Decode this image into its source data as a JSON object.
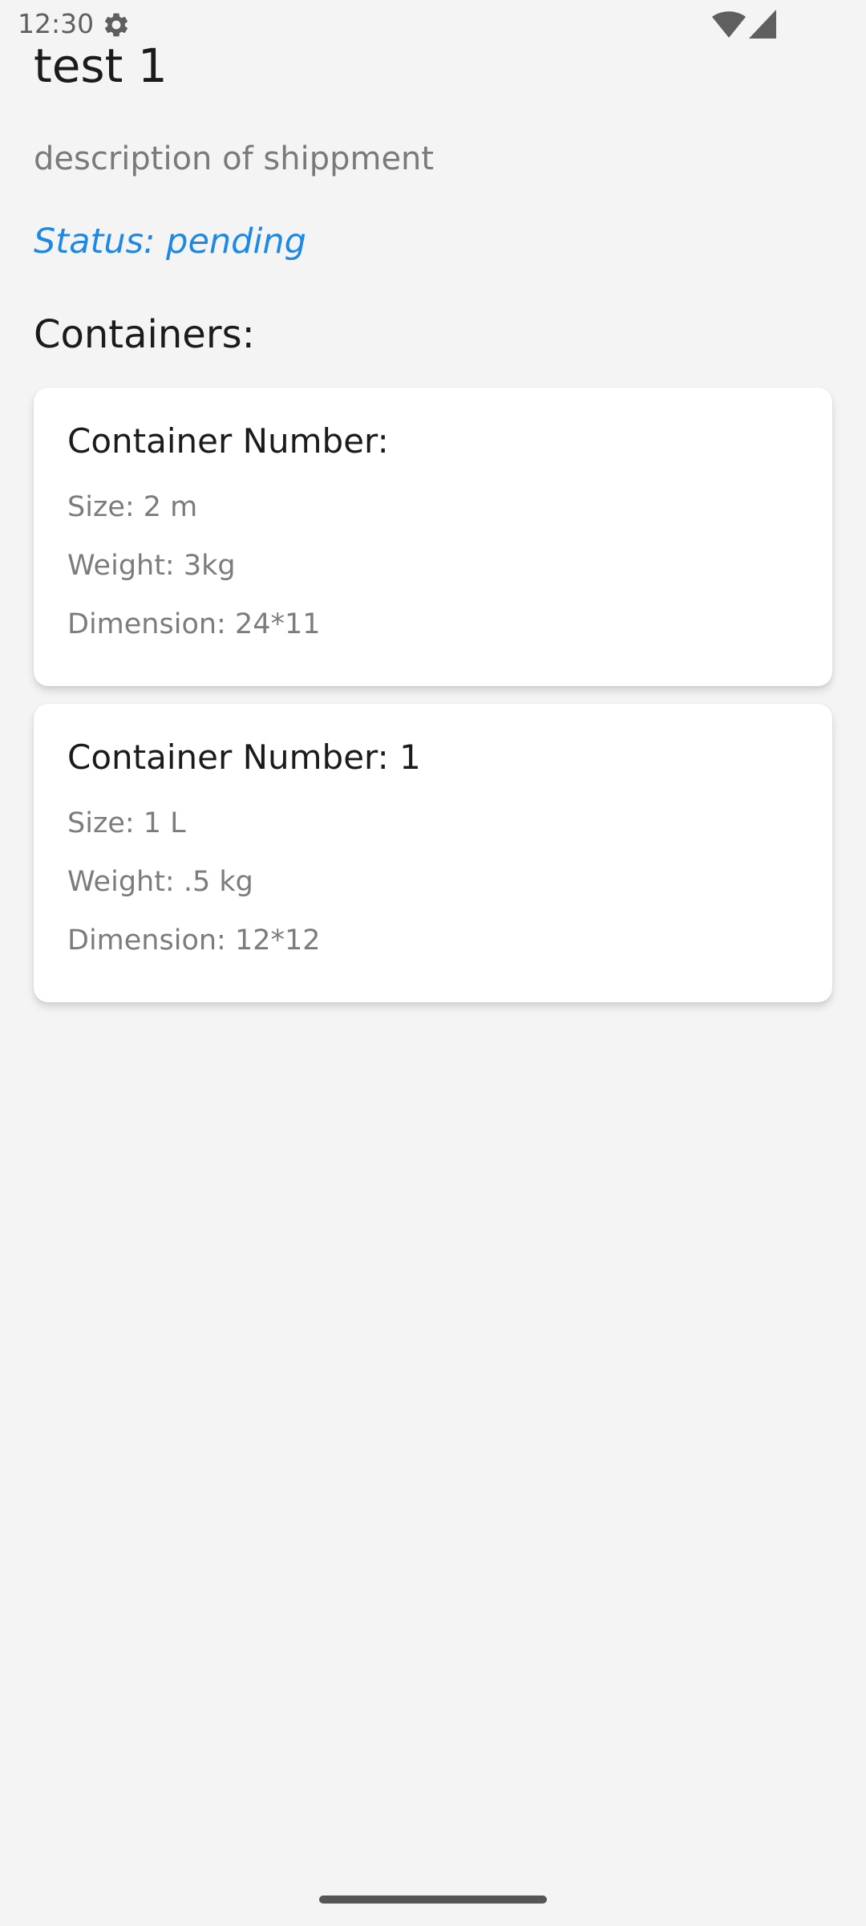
{
  "status_bar": {
    "time": "12:30",
    "icons": [
      "gear-icon",
      "wifi-icon",
      "signal-icon"
    ]
  },
  "shipment": {
    "title": "test 1",
    "description": "description of shippment",
    "status": "Status: pending"
  },
  "containers_heading": "Containers:",
  "containers": [
    {
      "number": "Container Number:",
      "size": "Size: 2 m",
      "weight": "Weight: 3kg",
      "dimension": "Dimension: 24*11"
    },
    {
      "number": "Container Number: 1",
      "size": "Size: 1 L",
      "weight": "Weight: .5 kg",
      "dimension": "Dimension: 12*12"
    }
  ],
  "colors": {
    "background": "#f4f4f4",
    "status_accent": "#1e88e5",
    "card": "#ffffff"
  }
}
